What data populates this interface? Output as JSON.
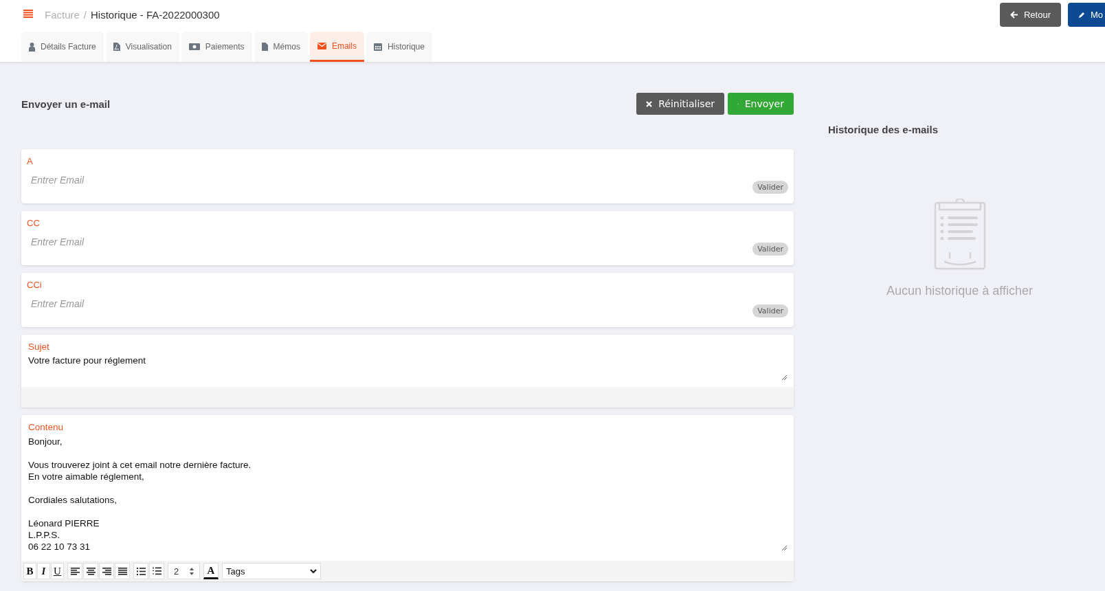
{
  "breadcrumb": {
    "parent": "Facture",
    "separator": "/",
    "current": "Historique - FA-2022000300"
  },
  "header_buttons": [
    {
      "label": "Retour",
      "kind": "back"
    },
    {
      "label": "Mo",
      "kind": "edit"
    }
  ],
  "tabs": [
    {
      "label": "Détails Facture",
      "selected": false
    },
    {
      "label": "Visualisation",
      "selected": false
    },
    {
      "label": "Paiements",
      "selected": false
    },
    {
      "label": "Mémos",
      "selected": false
    },
    {
      "label": "Emails",
      "selected": true
    },
    {
      "label": "Historique",
      "selected": false
    }
  ],
  "form": {
    "title": "Envoyer un e-mail",
    "reset_button": "Réinitialiser",
    "send_button": "Envoyer",
    "recipients": [
      {
        "label": "A",
        "placeholder": "Entrer Email",
        "button": "Valider"
      },
      {
        "label": "CC",
        "placeholder": "Entrer Email",
        "button": "Valider"
      },
      {
        "label": "CCi",
        "placeholder": "Entrer Email",
        "button": "Valider"
      }
    ],
    "subject": {
      "label": "Sujet",
      "value": "Votre facture pour réglement"
    },
    "content": {
      "label": "Contenu",
      "paragraphs": [
        "Bonjour,",
        "Vous trouverez joint à cet email notre dernière facture.\nEn votre aimable réglement,",
        "Cordiales salutations,",
        "Léonard PIERRE\nL.P.P.S.\n06 22 10 73 31"
      ]
    },
    "toolbar": {
      "format_buttons": [
        {
          "label": "B",
          "kind": "bold"
        },
        {
          "label": "I",
          "kind": "italic"
        },
        {
          "label": "U",
          "kind": "underline"
        }
      ],
      "font_size": "2",
      "color_button": "A",
      "tags_select": "Tags"
    }
  },
  "history": {
    "title": "Historique des e-mails",
    "empty_message": "Aucun historique à afficher"
  }
}
